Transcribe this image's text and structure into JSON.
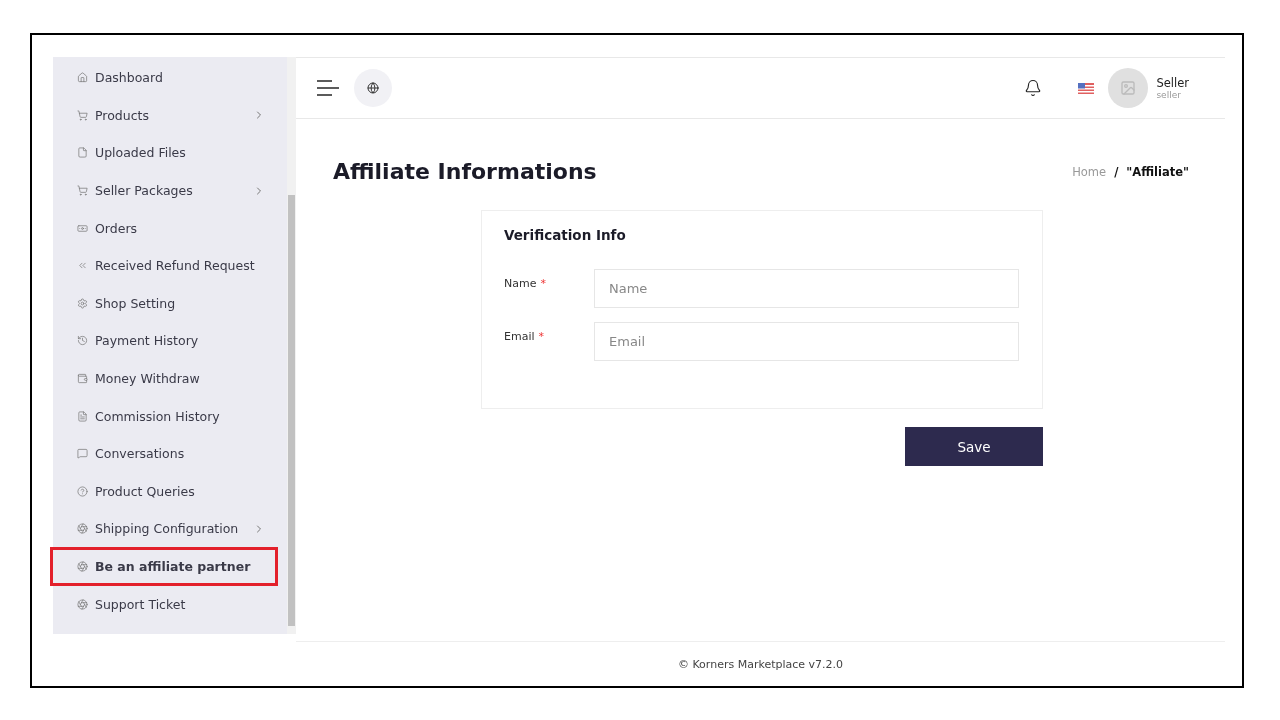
{
  "sidebar": {
    "items": [
      {
        "label": "Dashboard",
        "has_submenu": false,
        "selected": false
      },
      {
        "label": "Products",
        "has_submenu": true,
        "selected": false
      },
      {
        "label": "Uploaded Files",
        "has_submenu": false,
        "selected": false
      },
      {
        "label": "Seller Packages",
        "has_submenu": true,
        "selected": false
      },
      {
        "label": "Orders",
        "has_submenu": false,
        "selected": false
      },
      {
        "label": "Received Refund Request",
        "has_submenu": false,
        "selected": false
      },
      {
        "label": "Shop Setting",
        "has_submenu": false,
        "selected": false
      },
      {
        "label": "Payment History",
        "has_submenu": false,
        "selected": false
      },
      {
        "label": "Money Withdraw",
        "has_submenu": false,
        "selected": false
      },
      {
        "label": "Commission History",
        "has_submenu": false,
        "selected": false
      },
      {
        "label": "Conversations",
        "has_submenu": false,
        "selected": false
      },
      {
        "label": "Product Queries",
        "has_submenu": false,
        "selected": false
      },
      {
        "label": "Shipping Configuration",
        "has_submenu": true,
        "selected": false
      },
      {
        "label": "Be an affiliate partner",
        "has_submenu": false,
        "selected": true
      },
      {
        "label": "Support Ticket",
        "has_submenu": false,
        "selected": false
      }
    ]
  },
  "topbar": {
    "user": {
      "name": "Seller",
      "role": "seller"
    }
  },
  "page": {
    "title": "Affiliate Informations",
    "breadcrumb": [
      {
        "label": "Home",
        "selected": false
      },
      {
        "label": "\"Affiliate\"",
        "selected": true
      }
    ],
    "breadcrumb_separator": "/"
  },
  "form": {
    "title": "Verification Info",
    "required_mark": "*",
    "fields": [
      {
        "label": "Name",
        "required": true,
        "placeholder": "Name"
      },
      {
        "label": "Email",
        "required": true,
        "placeholder": "Email"
      }
    ],
    "submit": "Save"
  },
  "footer": {
    "text": "© Korners Marketplace v7.2.0"
  }
}
